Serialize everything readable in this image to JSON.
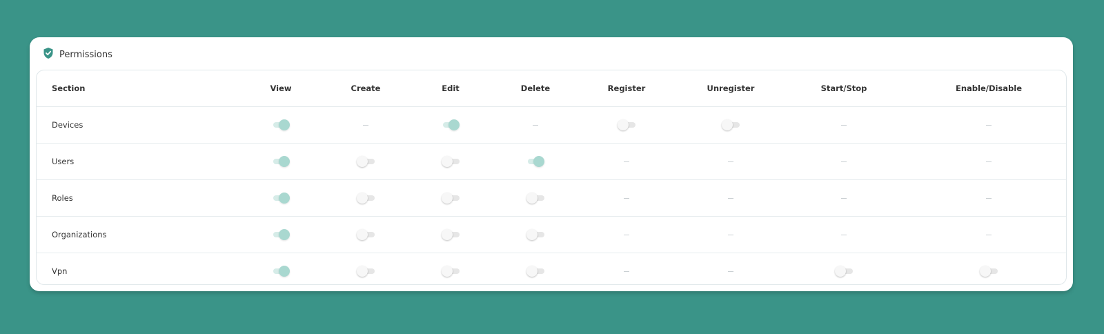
{
  "card": {
    "title": "Permissions",
    "icon": "shield-check-icon"
  },
  "colors": {
    "background": "#3a9488",
    "toggle_on": "#a9d8d0",
    "toggle_off": "#f7f7f7"
  },
  "table": {
    "columns": [
      "Section",
      "View",
      "Create",
      "Edit",
      "Delete",
      "Register",
      "Unregister",
      "Start/Stop",
      "Enable/Disable"
    ],
    "rows": [
      {
        "section": "Devices",
        "cells": [
          "on",
          "none",
          "on",
          "none",
          "off",
          "off",
          "none",
          "none"
        ]
      },
      {
        "section": "Users",
        "cells": [
          "on",
          "off",
          "off",
          "on",
          "none",
          "none",
          "none",
          "none"
        ]
      },
      {
        "section": "Roles",
        "cells": [
          "on",
          "off",
          "off",
          "off",
          "none",
          "none",
          "none",
          "none"
        ]
      },
      {
        "section": "Organizations",
        "cells": [
          "on",
          "off",
          "off",
          "off",
          "none",
          "none",
          "none",
          "none"
        ]
      },
      {
        "section": "Vpn",
        "cells": [
          "on",
          "off",
          "off",
          "off",
          "none",
          "none",
          "off",
          "off"
        ]
      }
    ]
  }
}
